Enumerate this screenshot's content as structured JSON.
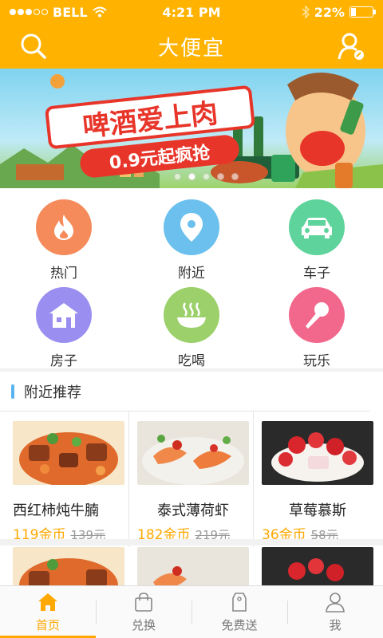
{
  "status": {
    "carrier": "BELL",
    "time": "4:21 PM",
    "battery": "22%",
    "battery_fraction": 0.22
  },
  "nav": {
    "title": "大便宜"
  },
  "banner": {
    "headline": "啤酒爱上肉",
    "subline": "0.9元起疯抢",
    "page_count": 5,
    "active_page": 1
  },
  "categories": [
    {
      "label": "热门",
      "icon": "flame-icon",
      "color": "#f58a5b"
    },
    {
      "label": "附近",
      "icon": "location-pin-icon",
      "color": "#6cc0ee"
    },
    {
      "label": "车子",
      "icon": "car-icon",
      "color": "#5ed49c"
    },
    {
      "label": "房子",
      "icon": "house-icon",
      "color": "#9a8ef0"
    },
    {
      "label": "吃喝",
      "icon": "food-bowl-icon",
      "color": "#9bd06a"
    },
    {
      "label": "玩乐",
      "icon": "microphone-icon",
      "color": "#f2688d"
    }
  ],
  "recommend": {
    "title": "附近推荐",
    "items": [
      {
        "name": "西红柿炖牛腩",
        "price": "119金币",
        "old_price": "139元"
      },
      {
        "name": "泰式薄荷虾",
        "price": "182金币",
        "old_price": "219元"
      },
      {
        "name": "草莓慕斯",
        "price": "36金币",
        "old_price": "58元"
      }
    ]
  },
  "tabs": [
    {
      "label": "首页",
      "icon": "home-icon",
      "active": true
    },
    {
      "label": "兑换",
      "icon": "shopping-bag-icon",
      "active": false
    },
    {
      "label": "免费送",
      "icon": "price-tag-icon",
      "active": false
    },
    {
      "label": "我",
      "icon": "person-icon",
      "active": false
    }
  ],
  "colors": {
    "brand": "#ffb300",
    "accent": "#ffa800"
  }
}
